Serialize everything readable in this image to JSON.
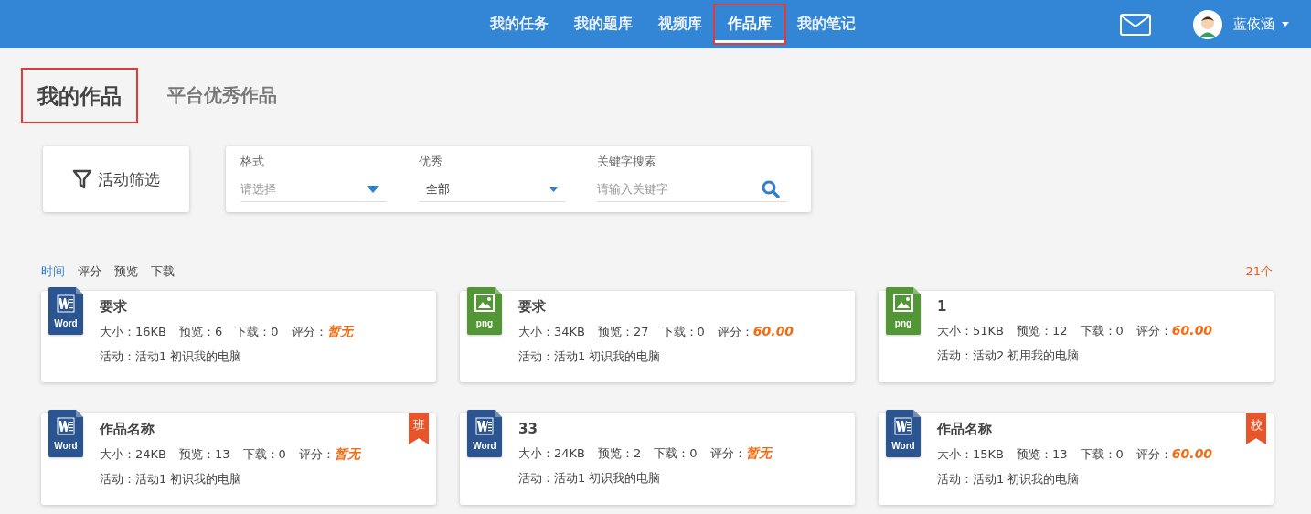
{
  "nav": {
    "items": [
      {
        "label": "我的任务",
        "selected": false,
        "highlighted": false
      },
      {
        "label": "我的题库",
        "selected": false,
        "highlighted": false
      },
      {
        "label": "视频库",
        "selected": false,
        "highlighted": false
      },
      {
        "label": "作品库",
        "selected": true,
        "highlighted": true
      },
      {
        "label": "我的笔记",
        "selected": false,
        "highlighted": false
      }
    ],
    "user": {
      "name": "蓝依涵"
    }
  },
  "page_tabs": [
    {
      "label": "我的作品",
      "selected": true,
      "highlighted": true
    },
    {
      "label": "平台优秀作品",
      "selected": false,
      "highlighted": false
    }
  ],
  "filter_button": {
    "label": "活动筛选"
  },
  "filters": [
    {
      "kind": "select",
      "label": "格式",
      "placeholder": "请选择"
    },
    {
      "kind": "select",
      "label": "优秀",
      "value": "全部"
    },
    {
      "kind": "search",
      "label": "关键字搜索",
      "placeholder": "请输入关键字"
    }
  ],
  "sort_options": [
    {
      "label": "时间",
      "selected": true
    },
    {
      "label": "评分",
      "selected": false
    },
    {
      "label": "预览",
      "selected": false
    },
    {
      "label": "下载",
      "selected": false
    }
  ],
  "count": "21个",
  "works": [
    {
      "kind": "word",
      "file_label": "Word",
      "title": "要求",
      "stats": [
        {
          "label": "大小：",
          "value": "16KB"
        },
        {
          "label": "预览：",
          "value": "6"
        },
        {
          "label": "下载：",
          "value": "0"
        }
      ],
      "score": {
        "label": "评分：",
        "value": "暂无"
      },
      "activity": "活动：活动1 初识我的电脑"
    },
    {
      "kind": "png",
      "file_label": "png",
      "title": "要求",
      "stats": [
        {
          "label": "大小：",
          "value": "34KB"
        },
        {
          "label": "预览：",
          "value": "27"
        },
        {
          "label": "下载：",
          "value": "0"
        }
      ],
      "score": {
        "label": "评分：",
        "value": "60.00"
      },
      "activity": "活动：活动1 初识我的电脑"
    },
    {
      "kind": "png",
      "file_label": "png",
      "title": "1",
      "stats": [
        {
          "label": "大小：",
          "value": "51KB"
        },
        {
          "label": "预览：",
          "value": "12"
        },
        {
          "label": "下载：",
          "value": "0"
        }
      ],
      "score": {
        "label": "评分：",
        "value": "60.00"
      },
      "activity": "活动：活动2 初用我的电脑"
    },
    {
      "kind": "word",
      "file_label": "Word",
      "title": "作品名称",
      "badge": "班",
      "stats": [
        {
          "label": "大小：",
          "value": "24KB"
        },
        {
          "label": "预览：",
          "value": "13"
        },
        {
          "label": "下载：",
          "value": "0"
        }
      ],
      "score": {
        "label": "评分：",
        "value": "暂无"
      },
      "activity": "活动：活动1 初识我的电脑"
    },
    {
      "kind": "word",
      "file_label": "Word",
      "title": "33",
      "stats": [
        {
          "label": "大小：",
          "value": "24KB"
        },
        {
          "label": "预览：",
          "value": "2"
        },
        {
          "label": "下载：",
          "value": "0"
        }
      ],
      "score": {
        "label": "评分：",
        "value": "暂无"
      },
      "activity": "活动：活动1 初识我的电脑"
    },
    {
      "kind": "word",
      "file_label": "Word",
      "title": "作品名称",
      "badge": "校",
      "stats": [
        {
          "label": "大小：",
          "value": "15KB"
        },
        {
          "label": "预览：",
          "value": "13"
        },
        {
          "label": "下载：",
          "value": "0"
        }
      ],
      "score": {
        "label": "评分：",
        "value": "60.00"
      },
      "activity": "活动：活动1 初识我的电脑"
    }
  ]
}
